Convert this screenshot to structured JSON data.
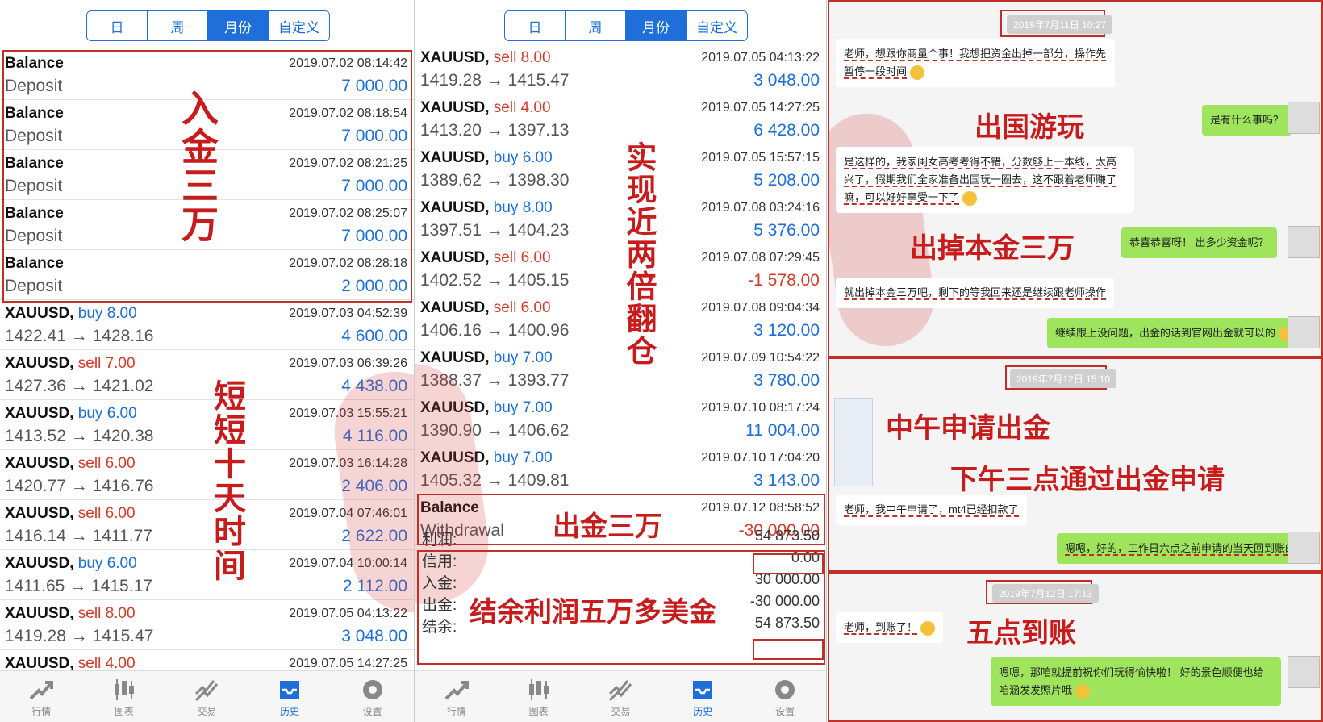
{
  "tabs": [
    "日",
    "周",
    "月份",
    "自定义"
  ],
  "active_tab": "月份",
  "panel1": {
    "rows": [
      {
        "sym": "Balance",
        "side": "",
        "lots": "",
        "sub": "Deposit",
        "time": "2019.07.02 08:14:42",
        "amount": "7 000.00",
        "neg": false
      },
      {
        "sym": "Balance",
        "side": "",
        "lots": "",
        "sub": "Deposit",
        "time": "2019.07.02 08:18:54",
        "amount": "7 000.00",
        "neg": false
      },
      {
        "sym": "Balance",
        "side": "",
        "lots": "",
        "sub": "Deposit",
        "time": "2019.07.02 08:21:25",
        "amount": "7 000.00",
        "neg": false
      },
      {
        "sym": "Balance",
        "side": "",
        "lots": "",
        "sub": "Deposit",
        "time": "2019.07.02 08:25:07",
        "amount": "7 000.00",
        "neg": false
      },
      {
        "sym": "Balance",
        "side": "",
        "lots": "",
        "sub": "Deposit",
        "time": "2019.07.02 08:28:18",
        "amount": "2 000.00",
        "neg": false
      },
      {
        "sym": "XAUUSD,",
        "side": "buy",
        "lots": "8.00",
        "sub": "1422.41 → 1428.16",
        "time": "2019.07.03 04:52:39",
        "amount": "4 600.00",
        "neg": false
      },
      {
        "sym": "XAUUSD,",
        "side": "sell",
        "lots": "7.00",
        "sub": "1427.36 → 1421.02",
        "time": "2019.07.03 06:39:26",
        "amount": "4 438.00",
        "neg": false
      },
      {
        "sym": "XAUUSD,",
        "side": "buy",
        "lots": "6.00",
        "sub": "1413.52 → 1420.38",
        "time": "2019.07.03 15:55:21",
        "amount": "4 116.00",
        "neg": false
      },
      {
        "sym": "XAUUSD,",
        "side": "sell",
        "lots": "6.00",
        "sub": "1420.77 → 1416.76",
        "time": "2019.07.03 16:14:28",
        "amount": "2 406.00",
        "neg": false
      },
      {
        "sym": "XAUUSD,",
        "side": "sell",
        "lots": "6.00",
        "sub": "1416.14 → 1411.77",
        "time": "2019.07.04 07:46:01",
        "amount": "2 622.00",
        "neg": false
      },
      {
        "sym": "XAUUSD,",
        "side": "buy",
        "lots": "6.00",
        "sub": "1411.65 → 1415.17",
        "time": "2019.07.04 10:00:14",
        "amount": "2 112.00",
        "neg": false
      },
      {
        "sym": "XAUUSD,",
        "side": "sell",
        "lots": "8.00",
        "sub": "1419.28 → 1415.47",
        "time": "2019.07.05 04:13:22",
        "amount": "3 048.00",
        "neg": false
      },
      {
        "sym": "XAUUSD,",
        "side": "sell",
        "lots": "4.00",
        "sub": "",
        "time": "2019.07.05 14:27:25",
        "amount": "",
        "neg": false
      }
    ],
    "annotations": {
      "deposit": "入金三万",
      "period": "短短十天时间"
    }
  },
  "panel2": {
    "rows": [
      {
        "sym": "XAUUSD,",
        "side": "sell",
        "lots": "8.00",
        "sub": "1419.28 → 1415.47",
        "time": "2019.07.05 04:13:22",
        "amount": "3 048.00",
        "neg": false
      },
      {
        "sym": "XAUUSD,",
        "side": "sell",
        "lots": "4.00",
        "sub": "1413.20 → 1397.13",
        "time": "2019.07.05 14:27:25",
        "amount": "6 428.00",
        "neg": false
      },
      {
        "sym": "XAUUSD,",
        "side": "buy",
        "lots": "6.00",
        "sub": "1389.62 → 1398.30",
        "time": "2019.07.05 15:57:15",
        "amount": "5 208.00",
        "neg": false
      },
      {
        "sym": "XAUUSD,",
        "side": "buy",
        "lots": "8.00",
        "sub": "1397.51 → 1404.23",
        "time": "2019.07.08 03:24:16",
        "amount": "5 376.00",
        "neg": false
      },
      {
        "sym": "XAUUSD,",
        "side": "sell",
        "lots": "6.00",
        "sub": "1402.52 → 1405.15",
        "time": "2019.07.08 07:29:45",
        "amount": "-1 578.00",
        "neg": true
      },
      {
        "sym": "XAUUSD,",
        "side": "sell",
        "lots": "6.00",
        "sub": "1406.16 → 1400.96",
        "time": "2019.07.08 09:04:34",
        "amount": "3 120.00",
        "neg": false
      },
      {
        "sym": "XAUUSD,",
        "side": "buy",
        "lots": "7.00",
        "sub": "1388.37 → 1393.77",
        "time": "2019.07.09 10:54:22",
        "amount": "3 780.00",
        "neg": false
      },
      {
        "sym": "XAUUSD,",
        "side": "buy",
        "lots": "7.00",
        "sub": "1390.90 → 1406.62",
        "time": "2019.07.10 08:17:24",
        "amount": "11 004.00",
        "neg": false
      },
      {
        "sym": "XAUUSD,",
        "side": "buy",
        "lots": "7.00",
        "sub": "1405.32 → 1409.81",
        "time": "2019.07.10 17:04:20",
        "amount": "3 143.00",
        "neg": false
      },
      {
        "sym": "Balance",
        "side": "",
        "lots": "",
        "sub": "Withdrawal",
        "time": "2019.07.12 08:58:52",
        "amount": "-30 000.00",
        "neg": true
      }
    ],
    "summary": [
      {
        "label": "利润:",
        "value": "54 873.50"
      },
      {
        "label": "信用:",
        "value": "0.00"
      },
      {
        "label": "入金:",
        "value": "30 000.00"
      },
      {
        "label": "出金:",
        "value": "-30 000.00"
      },
      {
        "label": "结余:",
        "value": "54 873.50"
      }
    ],
    "annotations": {
      "double": "实现近两倍翻仓",
      "withdraw": "出金三万",
      "balance": "结余利润五万多美金"
    }
  },
  "tabbar": [
    {
      "label": "行情",
      "icon": "quotes-icon"
    },
    {
      "label": "图表",
      "icon": "chart-icon"
    },
    {
      "label": "交易",
      "icon": "trade-icon"
    },
    {
      "label": "历史",
      "icon": "history-icon"
    },
    {
      "label": "设置",
      "icon": "settings-icon"
    }
  ],
  "active_tabbar": "历史",
  "chat": {
    "s1": {
      "time": "2019年7月11日 10:27",
      "m1": "老师，想跟你商量个事！我想把资金出掉一部分，操作先暂停一段时间",
      "m2": "是有什么事吗？",
      "m3": "是这样的，我家闺女高考考得不错，分数够上一本线，太高兴了，假期我们全家准备出国玩一圈去，这不跟着老师赚了嘛，可以好好享受一下了",
      "m4": "恭喜恭喜呀！ 出多少资金呢？",
      "m5": "就出掉本金三万吧，剩下的等我回来还是继续跟老师操作",
      "m6": "继续跟上没问题，出金的话到官网出金就可以的",
      "a1": "出国游玩",
      "a2": "出掉本金三万"
    },
    "s2": {
      "time": "2019年7月12日 15:10",
      "m1": "老师，我中午申请了，mt4已经扣款了",
      "m2": "嗯嗯，好的，工作日六点之前申请的当天回到账的",
      "a1": "中午申请出金",
      "a2": "下午三点通过出金申请"
    },
    "s3": {
      "time": "2019年7月12日 17:13",
      "m1": "老师，到账了！",
      "m2": "嗯嗯，那咱就提前祝你们玩得愉快啦！ 好的景色顺便也给咱涵发发照片哦",
      "a1": "五点到账"
    }
  }
}
